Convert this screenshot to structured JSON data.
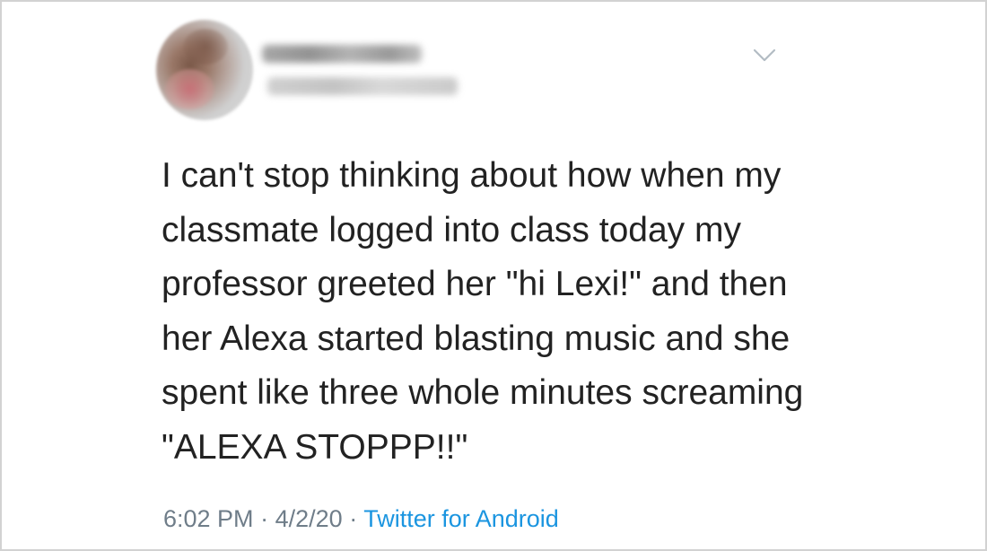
{
  "tweet": {
    "lines": [
      "I can't stop thinking about how when my",
      "classmate logged into class today my",
      "professor greeted her \"hi Lexi!\" and then",
      "her Alexa started blasting music and she",
      "spent like three whole minutes screaming",
      "\"ALEXA STOPPP!!\""
    ]
  },
  "meta": {
    "time": "6:02 PM",
    "separator": "·",
    "date": "4/2/20",
    "source": "Twitter for Android"
  },
  "colors": {
    "text": "#222222",
    "meta": "#6f7d89",
    "link": "#1b95e0",
    "chevron": "#b3bcc4"
  },
  "icons": {
    "menu": "chevron-down-icon"
  }
}
